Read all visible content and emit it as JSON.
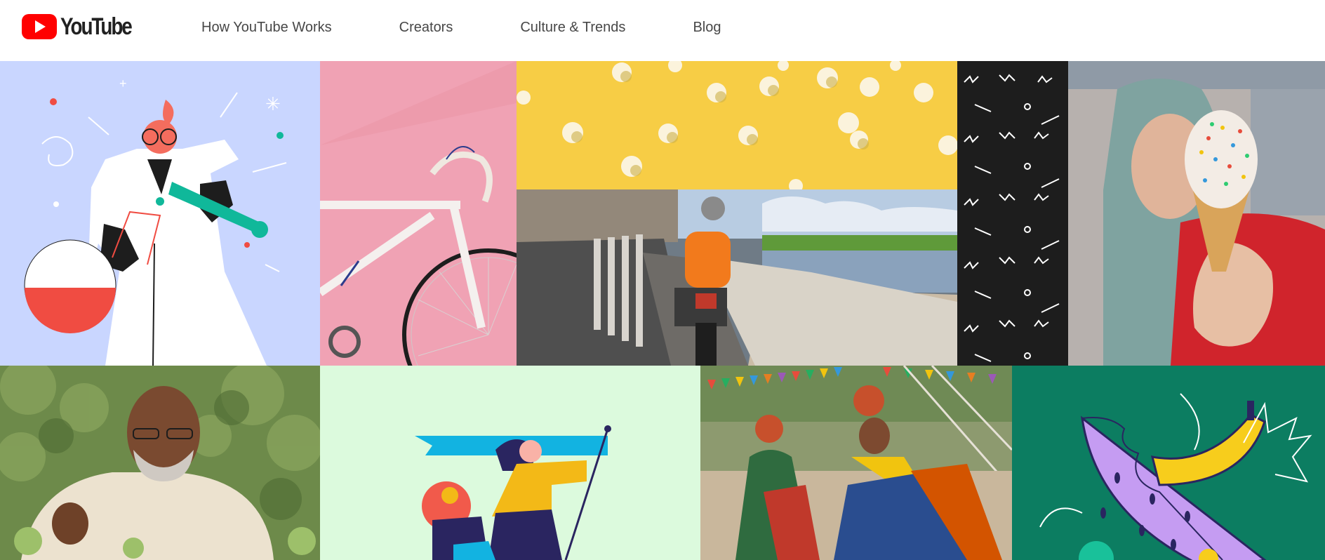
{
  "brand": {
    "name": "YouTube",
    "icon": "youtube-play-icon",
    "red": "#ff0000"
  },
  "nav": [
    {
      "label": "How YouTube Works"
    },
    {
      "label": "Creators"
    },
    {
      "label": "Culture & Trends"
    },
    {
      "label": "Blog"
    }
  ],
  "mosaic": [
    {
      "name": "scientist-illustration",
      "bg": "#c9d6ff"
    },
    {
      "name": "bicycle-photo",
      "bg": "#f0a2b4"
    },
    {
      "name": "popcorn-photo",
      "bg": "#f7cd45"
    },
    {
      "name": "motorcycle-riverside-photo",
      "bg": "#8b9aa6"
    },
    {
      "name": "black-pattern-tile",
      "bg": "#1d1d1d"
    },
    {
      "name": "ice-cream-photo",
      "bg": "#b9b3b0"
    },
    {
      "name": "gardener-photo",
      "bg": "#6e8a4d"
    },
    {
      "name": "hikers-illustration",
      "bg": "#dcfadd"
    },
    {
      "name": "dancers-photo",
      "bg": "#9c8c6c"
    },
    {
      "name": "fruit-illustration",
      "bg": "#0c7d61"
    }
  ]
}
